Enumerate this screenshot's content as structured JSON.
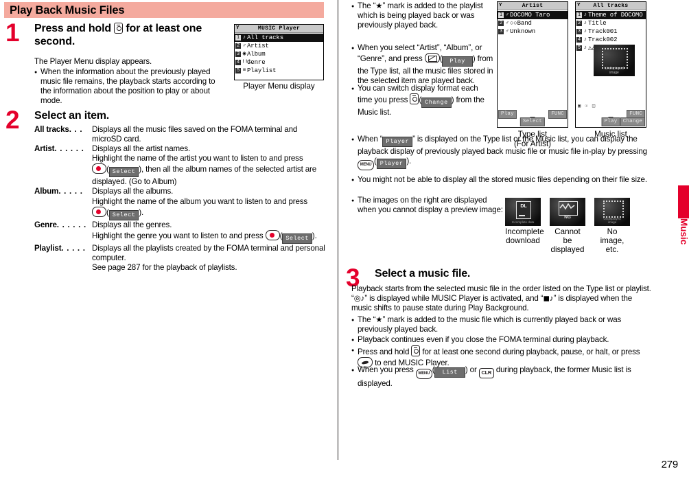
{
  "document": {
    "page_number": "279",
    "side_tab": "Music",
    "section_title": "Play Back Music Files"
  },
  "steps": {
    "one": {
      "number": "1",
      "title_a": "Press and hold",
      "title_b": "for at least one",
      "title_c": "second.",
      "lead": "The Player Menu display appears.",
      "bullet": "When the information about the previously played music file remains, the playback starts according to the information about the position to play or about mode."
    },
    "two": {
      "number": "2",
      "title": "Select an item.",
      "items": [
        {
          "term": "All tracks",
          "dots": ". . .",
          "lines": [
            "Displays all the music files saved on the FOMA terminal and",
            "microSD card."
          ]
        },
        {
          "term": "Artist",
          "dots": ". . . . . .",
          "lines": [
            "Displays all the artist names.",
            "Highlight the name of the artist you want to listen to and press"
          ],
          "key_line_pre": "",
          "key_line_post": "), then all the album names of the selected artist are",
          "key_softlabel": "Select",
          "tail": "displayed. (Go to Album)"
        },
        {
          "term": "Album",
          "dots": ". . . . .",
          "lines": [
            "Displays all the albums.",
            "Highlight the name of the album you want to listen to and press"
          ],
          "key_line_post": ").",
          "key_softlabel": "Select"
        },
        {
          "term": "Genre",
          "dots": ". . . . . .",
          "lines": [
            "Displays all the genres."
          ],
          "inline_pre": "Highlight the genre you want to listen to and press",
          "inline_post": ").",
          "key_softlabel": "Select"
        },
        {
          "term": "Playlist",
          "dots": ". . . . .",
          "lines": [
            "Displays all the playlists created by the FOMA terminal and personal",
            "computer.",
            "See page 287 for the playback of playlists."
          ]
        }
      ]
    },
    "three": {
      "number": "3",
      "title": "Select a music file.",
      "lead_a": "Playback starts from the selected music file in the order listed on the Type list or playlist. “",
      "lead_b": "” is displayed while MUSIC Player is activated, and “",
      "lead_c": "” is displayed when the music shifts to pause state during Play Background.",
      "bullets": [
        "The “★” mark is added to the music file which is currently played back or was previously played back.",
        "Playback continues even if you close the FOMA terminal during playback."
      ],
      "bullet_hold_a": "Press and hold",
      "bullet_hold_b": "for at least one second during playback, pause, or halt, or",
      "bullet_hold_c": "press",
      "bullet_hold_d": "to end MUSIC Player.",
      "bullet_list_a": "When you press",
      "bullet_list_soft": "List",
      "bullet_list_b": ") or",
      "bullet_list_c": "during playback, the former Music list is",
      "bullet_list_d": "displayed."
    }
  },
  "right_notes": {
    "n1": "The “★” mark is added to the playlist which is being played back or was previously played back.",
    "n2_a": "When you select “Artist”, “Album”, or “Genre”, and press",
    "n2_soft": "Play",
    "n2_b": ") from the Type list, all the music files stored in the selected item are played back.",
    "n3_a": "You can switch display format each time you press",
    "n3_soft": "Change",
    "n3_b": ") from the Music list.",
    "n4_a": "When “",
    "n4_soft": "Player",
    "n4_b": "” is displayed on the Type list or the Music list,",
    "n4_c": "you can display the playback display of previously played back music file or music file in-play by pressing",
    "n4_soft2": "Player",
    "n4_d": ").",
    "n5": "You might not be able to display all the stored music files depending on their file size.",
    "n6": "The images on the right are displayed when you cannot display a preview image:"
  },
  "screens": {
    "player_menu": {
      "caption": "Player Menu display",
      "status_title": "MUSIC Player",
      "rows": [
        {
          "idx": "1",
          "icon": "♪",
          "label": "All tracks",
          "selected": true
        },
        {
          "idx": "2",
          "icon": "♂",
          "label": "Artist",
          "selected": false
        },
        {
          "idx": "3",
          "icon": "◉",
          "label": "Album",
          "selected": false
        },
        {
          "idx": "4",
          "icon": "!!!",
          "label": "Genre",
          "selected": false
        },
        {
          "idx": "5",
          "icon": "≡",
          "label": "Playlist",
          "selected": false
        }
      ]
    },
    "type_list": {
      "caption_line1": "Type list",
      "caption_line2": "(For Artist)",
      "status_title": "Artist",
      "rows": [
        {
          "idx": "1",
          "icon": "♂",
          "label": "DOCOMO Taro",
          "selected": true
        },
        {
          "idx": "2",
          "icon": "♂",
          "label": "○○Band",
          "selected": false
        },
        {
          "idx": "3",
          "icon": "♂",
          "label": "Unknown",
          "selected": false
        }
      ],
      "softkeys": {
        "left": "Play",
        "center": "Select",
        "right": "FUNC"
      }
    },
    "music_list": {
      "caption": "Music list",
      "status_title": "All tracks",
      "rows": [
        {
          "idx": "1",
          "icon": "♪",
          "label": "Theme of DOCOMO",
          "selected": true
        },
        {
          "idx": "2",
          "icon": "♪",
          "label": "Title",
          "selected": false
        },
        {
          "idx": "3",
          "icon": "♪",
          "label": "Track001",
          "selected": false
        },
        {
          "idx": "4",
          "icon": "♪",
          "label": "Track002",
          "selected": false
        },
        {
          "idx": "5",
          "icon": "♪",
          "label": "△△Music",
          "selected": false
        }
      ],
      "album_art_label_1": "Undisplayed",
      "album_art_label_2": "image",
      "softkeys": {
        "center": "Play",
        "right_top": "FUNC",
        "right_bottom": "Change"
      }
    }
  },
  "thumbnails": [
    {
      "name": "incomplete-download",
      "art_label": "Incomplete data",
      "badge": "DL",
      "caption_line1": "Incomplete",
      "caption_line2": "download"
    },
    {
      "name": "cannot-be-displayed",
      "art_label": "NG",
      "badge": "NG",
      "caption_line1": "Cannot be",
      "caption_line2": "displayed"
    },
    {
      "name": "no-image",
      "art_label_1": "Undisplayed",
      "art_label_2": "image",
      "caption_line1": "No image,",
      "caption_line2": "etc."
    }
  ],
  "colors": {
    "accent_red": "#e4002b",
    "header_pink": "#f4aa9e",
    "text": "#000000"
  }
}
